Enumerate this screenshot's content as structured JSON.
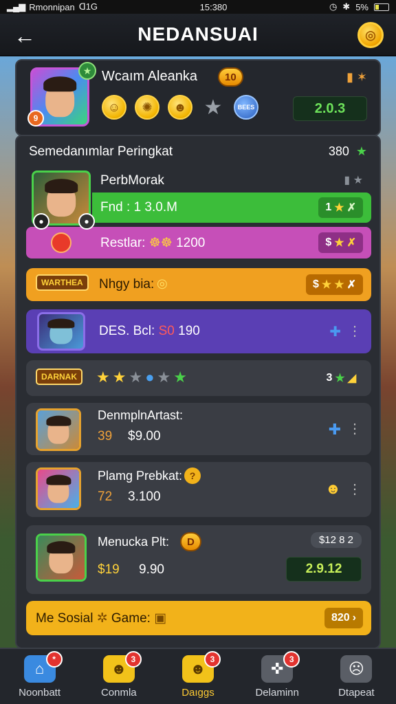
{
  "status_bar": {
    "carrier": "Rmonnipan",
    "network": "ᗡ1G",
    "time": "15:380",
    "battery": "5%"
  },
  "header": {
    "title": "NEDANSUAI"
  },
  "profile": {
    "name": "Wcaım Aleanka",
    "level": "10",
    "avatar_level": "9",
    "medal_badge": "BEES",
    "score": "2.0.3"
  },
  "board": {
    "title": "Semedanımlar Peringkat",
    "count": "380",
    "rows": [
      {
        "name": "PerbMorak",
        "green_text": "Fnd : 1 3.0.M",
        "green_value": "1",
        "pink_text": "Restlar:",
        "pink_icons": "☸☸",
        "pink_value": "1200",
        "pink_trail": "$"
      },
      {
        "badge": "WARTHEA",
        "text": "Nhgy bia:",
        "trail": "$"
      },
      {
        "text": "DES. Bcl:",
        "code": "S0",
        "code2": "190"
      },
      {
        "badge": "DARNAK",
        "trail_num": "3"
      },
      {
        "name": "DenmplnArtast:",
        "num": "39",
        "value": "$9.00"
      },
      {
        "name": "Plamg Prebkat:",
        "num": "72",
        "value": "3.100"
      },
      {
        "name": "Menucka Plt:",
        "chip": "D",
        "num": "$19",
        "value": "9.90",
        "top_right": "$12 8 2",
        "score": "2.9.12"
      }
    ],
    "footer": {
      "text": "Me Sosial",
      "text2": "Game:",
      "value": "820"
    }
  },
  "nav": [
    {
      "label": "Noonbatt",
      "badge": "*"
    },
    {
      "label": "Conmla",
      "badge": "3"
    },
    {
      "label": "Daıggs",
      "badge": "3"
    },
    {
      "label": "Delaminn",
      "badge": "3"
    },
    {
      "label": "Dtapeat",
      "badge": ""
    }
  ],
  "colors": {
    "green_bar": "#3cbd3a",
    "pink_bar": "#c64fb8",
    "orange_bar": "#f0a020",
    "purple_bar": "#5a3fb4",
    "gold_bar": "#f2b21a"
  }
}
